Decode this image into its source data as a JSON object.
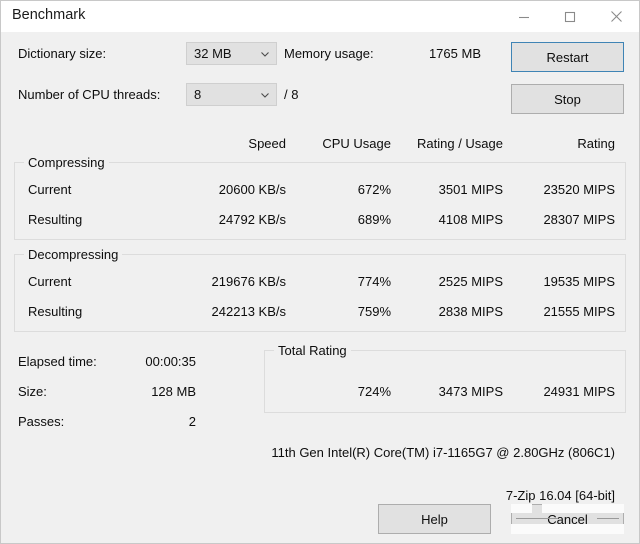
{
  "window": {
    "title": "Benchmark",
    "controls": [
      {
        "name": "minimize",
        "glyph": "minimize-icon"
      },
      {
        "name": "maximize",
        "glyph": "maximize-icon"
      },
      {
        "name": "close",
        "glyph": "close-icon"
      }
    ]
  },
  "settings": {
    "dictionary_label": "Dictionary size:",
    "dictionary_value": "32 MB",
    "threads_label": "Number of CPU threads:",
    "threads_value": "8",
    "threads_total": "/ 8",
    "memory_label": "Memory usage:",
    "memory_value": "1765 MB"
  },
  "actions": {
    "restart": "Restart",
    "stop": "Stop",
    "help": "Help",
    "cancel": "Cancel"
  },
  "columns": {
    "speed": "Speed",
    "cpu_usage": "CPU Usage",
    "rating_usage": "Rating / Usage",
    "rating": "Rating"
  },
  "compressing": {
    "title": "Compressing",
    "rows": [
      {
        "label": "Current",
        "speed": "20600 KB/s",
        "cpu_usage": "672%",
        "rating_usage": "3501 MIPS",
        "rating": "23520 MIPS"
      },
      {
        "label": "Resulting",
        "speed": "24792 KB/s",
        "cpu_usage": "689%",
        "rating_usage": "4108 MIPS",
        "rating": "28307 MIPS"
      }
    ]
  },
  "decompressing": {
    "title": "Decompressing",
    "rows": [
      {
        "label": "Current",
        "speed": "219676 KB/s",
        "cpu_usage": "774%",
        "rating_usage": "2525 MIPS",
        "rating": "19535 MIPS"
      },
      {
        "label": "Resulting",
        "speed": "242213 KB/s",
        "cpu_usage": "759%",
        "rating_usage": "2838 MIPS",
        "rating": "21555 MIPS"
      }
    ]
  },
  "stats": {
    "elapsed_label": "Elapsed time:",
    "elapsed_value": "00:00:35",
    "size_label": "Size:",
    "size_value": "128 MB",
    "passes_label": "Passes:",
    "passes_value": "2"
  },
  "total_rating": {
    "title": "Total Rating",
    "cpu_usage": "724%",
    "rating_usage": "3473 MIPS",
    "rating": "24931 MIPS"
  },
  "footer": {
    "cpu_info": "11th Gen Intel(R) Core(TM) i7-1165G7 @ 2.80GHz (806C1)",
    "version": "7-Zip 16.04 [64-bit]"
  },
  "colors": {
    "window_bg": "#f0f0f0",
    "titlebar_bg": "#ffffff",
    "control_bg": "#e1e1e1",
    "focus_border": "#3f84b5",
    "group_border": "#dcdcdc",
    "text": "#0d0d0d"
  }
}
